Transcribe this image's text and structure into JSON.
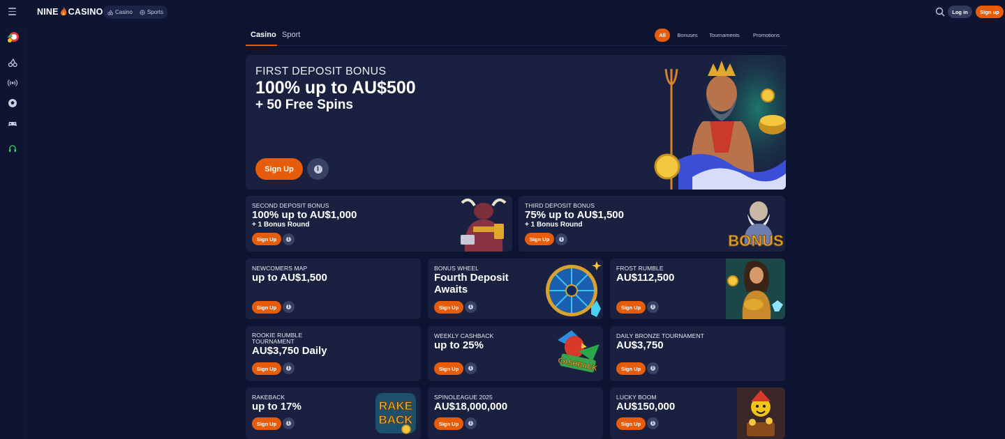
{
  "header": {
    "logo_left": "NINE",
    "logo_right": "CASINO",
    "nav": [
      {
        "label": "Casino",
        "icon": "cherries-icon"
      },
      {
        "label": "Sports",
        "icon": "ball-icon"
      }
    ],
    "login_label": "Log in",
    "signup_label": "Sign up"
  },
  "sidebar": {
    "items": [
      {
        "name": "promo-icon"
      },
      {
        "name": "cherries-icon"
      },
      {
        "name": "live-icon"
      },
      {
        "name": "football-icon"
      },
      {
        "name": "gamepad-icon"
      },
      {
        "name": "support-icon"
      }
    ]
  },
  "tabs": {
    "casino": "Casino",
    "sport": "Sport"
  },
  "filters": {
    "all": "All",
    "bonuses": "Bonuses",
    "tournaments": "Tournaments",
    "promotions": "Promotions"
  },
  "hero": {
    "subtitle": "FIRST DEPOSIT BONUS",
    "title": "100% up to  AU$500",
    "extra": "+ 50 Free Spins",
    "cta": "Sign Up"
  },
  "cards": [
    {
      "sub": "SECOND DEPOSIT BONUS",
      "title": "100% up to  AU$1,000",
      "extra": "+ 1 Bonus Round",
      "cta": "Sign Up"
    },
    {
      "sub": "THIRD DEPOSIT BONUS",
      "title": "75% up to  AU$1,500",
      "extra": "+ 1 Bonus Round",
      "cta": "Sign Up",
      "art_text": "BONUS"
    },
    {
      "sub": "NEWCOMERS MAP",
      "title": "up to AU$1,500",
      "cta": "Sign Up"
    },
    {
      "sub": "BONUS WHEEL",
      "title": "Fourth Deposit Awaits",
      "cta": "Sign Up"
    },
    {
      "sub": "FROST RUMBLE",
      "title": "AU$112,500",
      "cta": "Sign Up"
    },
    {
      "sub": "ROOKIE RUMBLE TOURNAMENT",
      "title": "AU$3,750 Daily",
      "cta": "Sign Up"
    },
    {
      "sub": "WEEKLY CASHBACK",
      "title": "up to 25%",
      "cta": "Sign Up",
      "art_text": "CASHBACK"
    },
    {
      "sub": "DAILY BRONZE TOURNAMENT",
      "title": "AU$3,750",
      "cta": "Sign Up"
    },
    {
      "sub": "RAKEBACK",
      "title": "up to 17%",
      "cta": "Sign Up",
      "art_text_1": "RAKE",
      "art_text_2": "BACK"
    },
    {
      "sub": "SPINOLEAGUE 2025",
      "title": "AU$18,000,000",
      "cta": "Sign Up"
    },
    {
      "sub": "LUCKY BOOM",
      "title": "AU$150,000",
      "cta": "Sign Up"
    }
  ],
  "colors": {
    "background": "#0d1431",
    "card": "#1a2140",
    "accent": "#e65c0a"
  }
}
